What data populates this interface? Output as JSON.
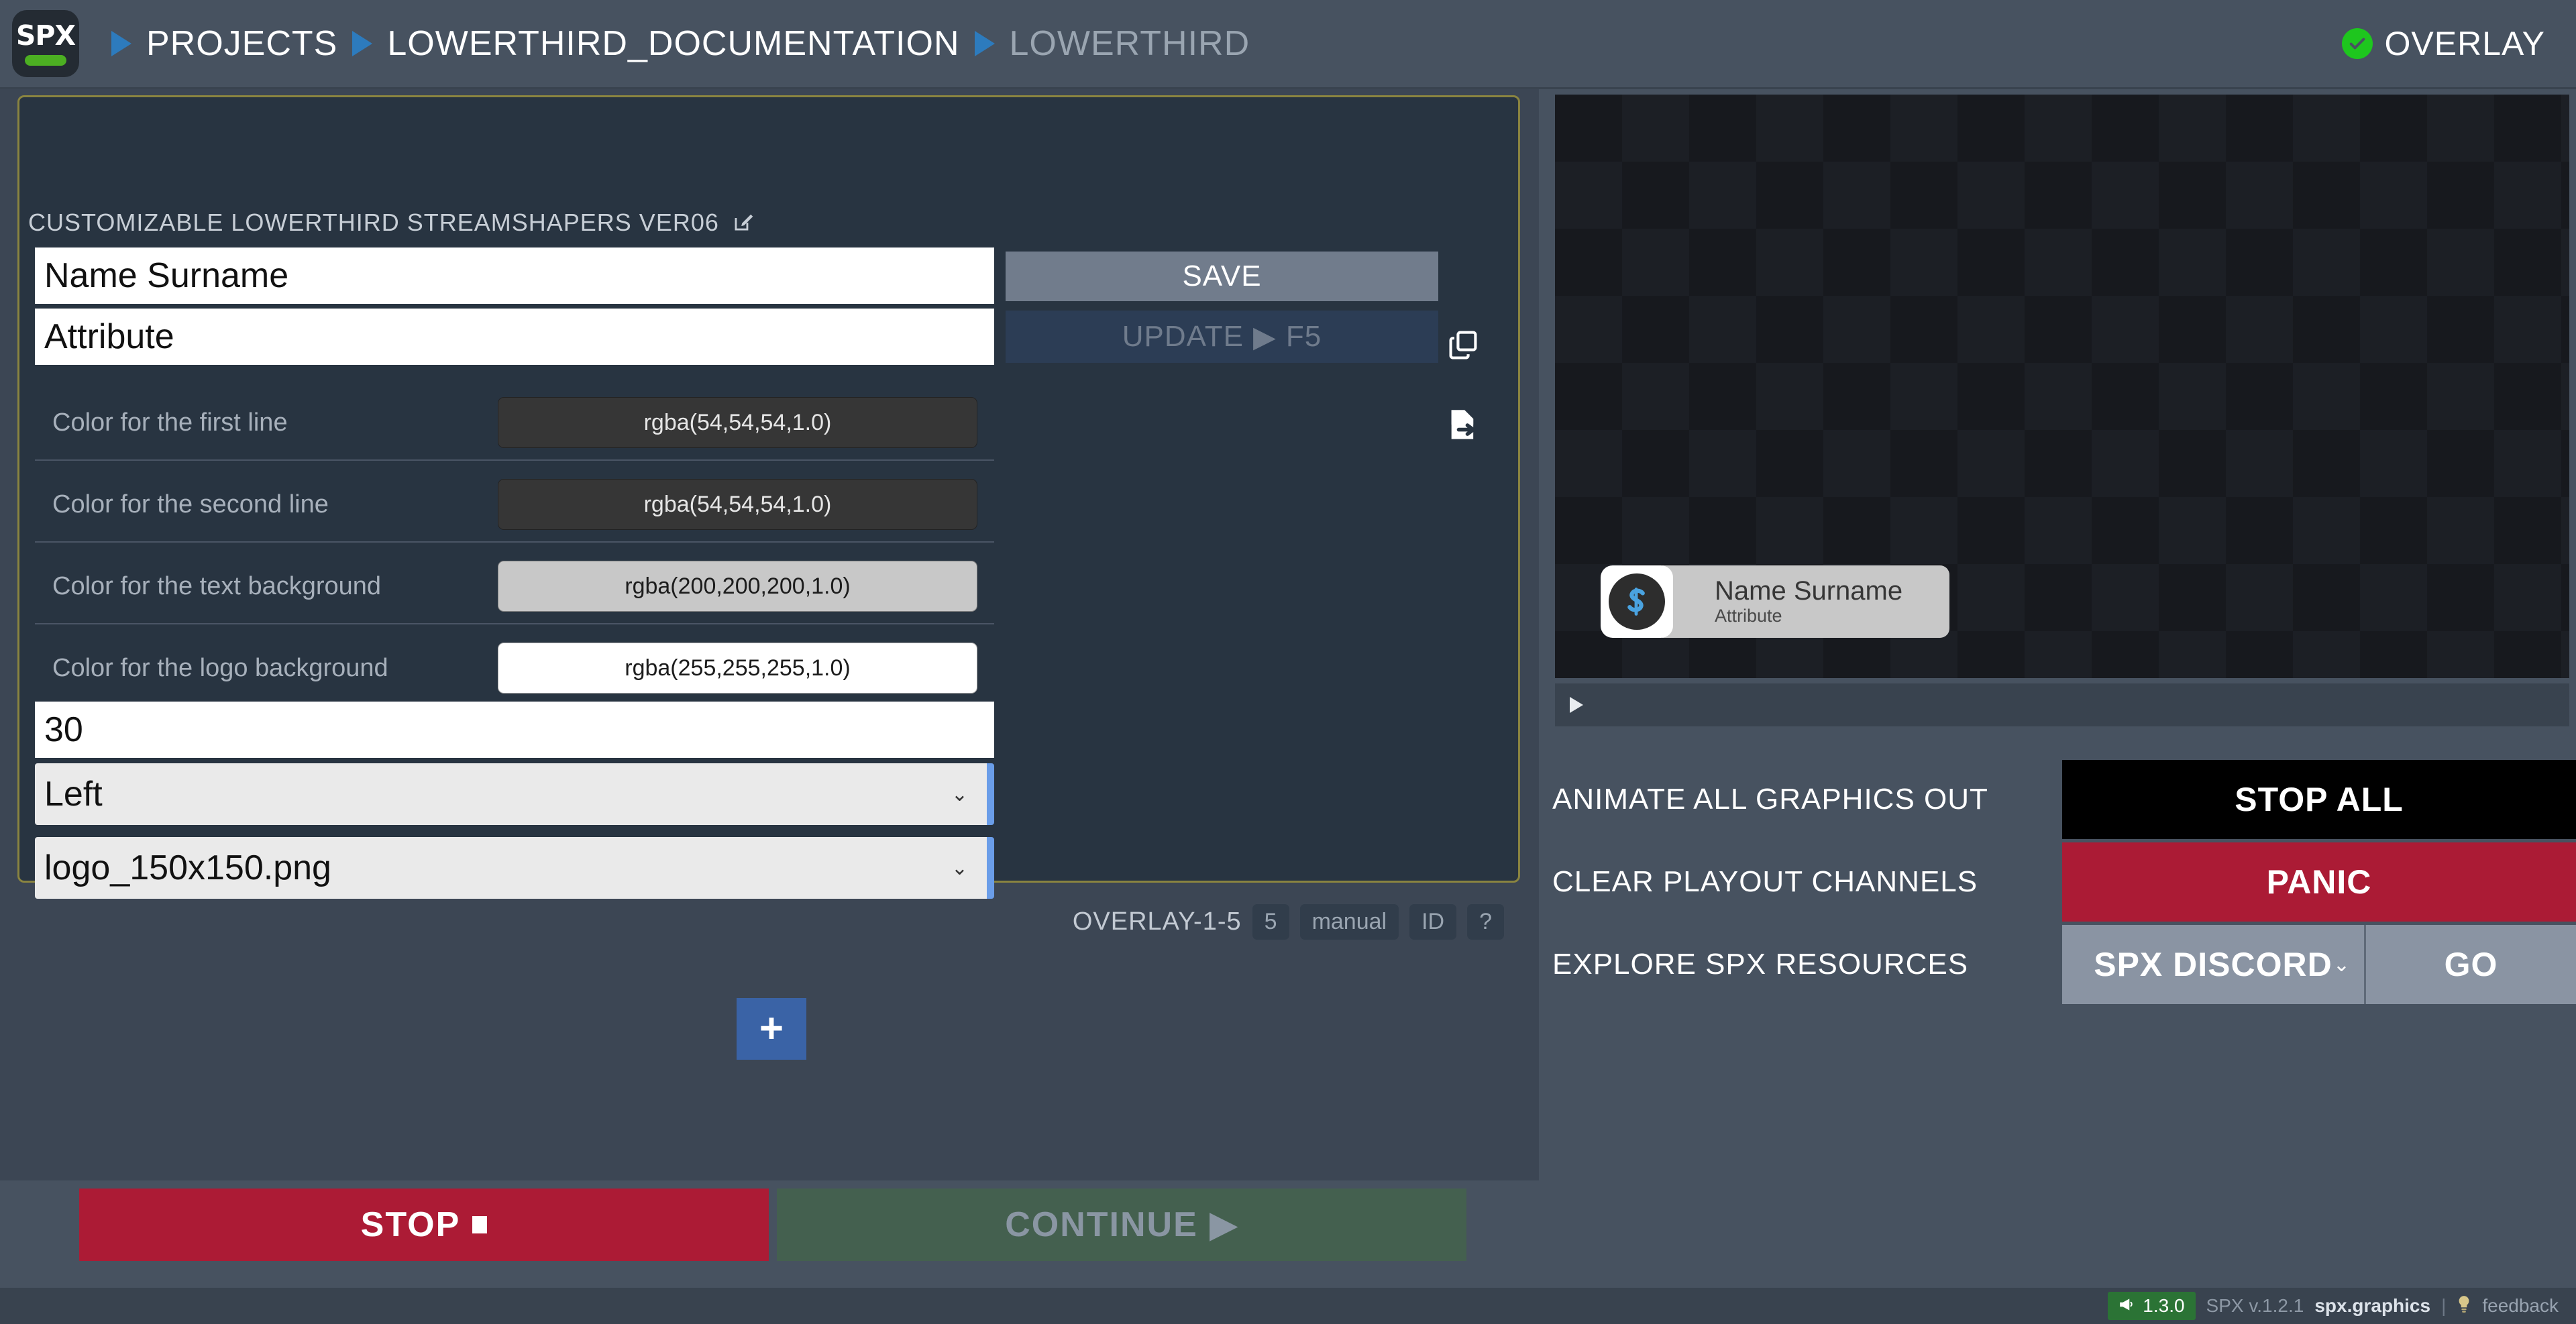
{
  "header": {
    "logo_text": "SPX",
    "breadcrumbs": [
      {
        "label": "PROJECTS",
        "current": false
      },
      {
        "label": "LOWERTHIRD_DOCUMENTATION",
        "current": false
      },
      {
        "label": "LOWERTHIRD",
        "current": true
      }
    ],
    "status_label": "OVERLAY",
    "status_icon": "check-circle-icon",
    "status_color": "#1ec61e"
  },
  "template": {
    "title": "CUSTOMIZABLE LOWERTHIRD STREAMSHAPERS VER06",
    "edit_icon": "edit-square-icon",
    "border_color": "#8a8440",
    "fields": {
      "line1_value": "Name Surname",
      "line2_value": "Attribute",
      "number_value": "30",
      "align_value": "Left",
      "logo_value": "logo_150x150.png"
    },
    "save_label": "SAVE",
    "update_label": "UPDATE",
    "update_play": "▶",
    "update_key": "F5",
    "side_icons": [
      {
        "name": "copy-icon"
      },
      {
        "name": "file-export-icon"
      }
    ],
    "colors": [
      {
        "label": "Color for the first line",
        "value": "rgba(54,54,54,1.0)",
        "swatch": "#363636",
        "style": "dark"
      },
      {
        "label": "Color for the second line",
        "value": "rgba(54,54,54,1.0)",
        "swatch": "#363636",
        "style": "dark"
      },
      {
        "label": "Color for the text background",
        "value": "rgba(200,200,200,1.0)",
        "swatch": "#c8c8c8",
        "style": "light"
      },
      {
        "label": "Color for the logo background",
        "value": "rgba(255,255,255,1.0)",
        "swatch": "#ffffff",
        "style": "white"
      }
    ],
    "meta": {
      "channel": "OVERLAY-1-5",
      "badges": [
        "5",
        "manual",
        "ID",
        "?"
      ]
    },
    "add_label": "+"
  },
  "transport": {
    "stop_label": "STOP",
    "stop_icon": "stop-square-icon",
    "continue_label": "CONTINUE",
    "continue_icon": "play-triangle-icon",
    "stop_color": "#ac1b35",
    "continue_color": "#44604f"
  },
  "preview": {
    "lower_third": {
      "name": "Name Surname",
      "attribute": "Attribute",
      "logo_icon": "spx-s-logo-icon",
      "logo_bg": "#ffffff",
      "text_bg": "#c8c8c8"
    },
    "play_icon": "play-triangle-icon"
  },
  "actions": [
    {
      "label": "ANIMATE ALL GRAPHICS OUT",
      "button": "STOP ALL",
      "color": "#000000"
    },
    {
      "label": "CLEAR PLAYOUT CHANNELS",
      "button": "PANIC",
      "color": "#ab1b35"
    },
    {
      "label": "EXPLORE SPX RESOURCES",
      "button": "SPX DISCORD",
      "go": "GO",
      "color": "#8a94a3"
    }
  ],
  "statusbar": {
    "version_badge": "1.3.0",
    "megaphone_icon": "megaphone-icon",
    "app_version": "SPX v.1.2.1",
    "site": "spx.graphics",
    "separator": "|",
    "bulb_icon": "lightbulb-icon",
    "feedback": "feedback",
    "badge_color": "#2b7335"
  }
}
